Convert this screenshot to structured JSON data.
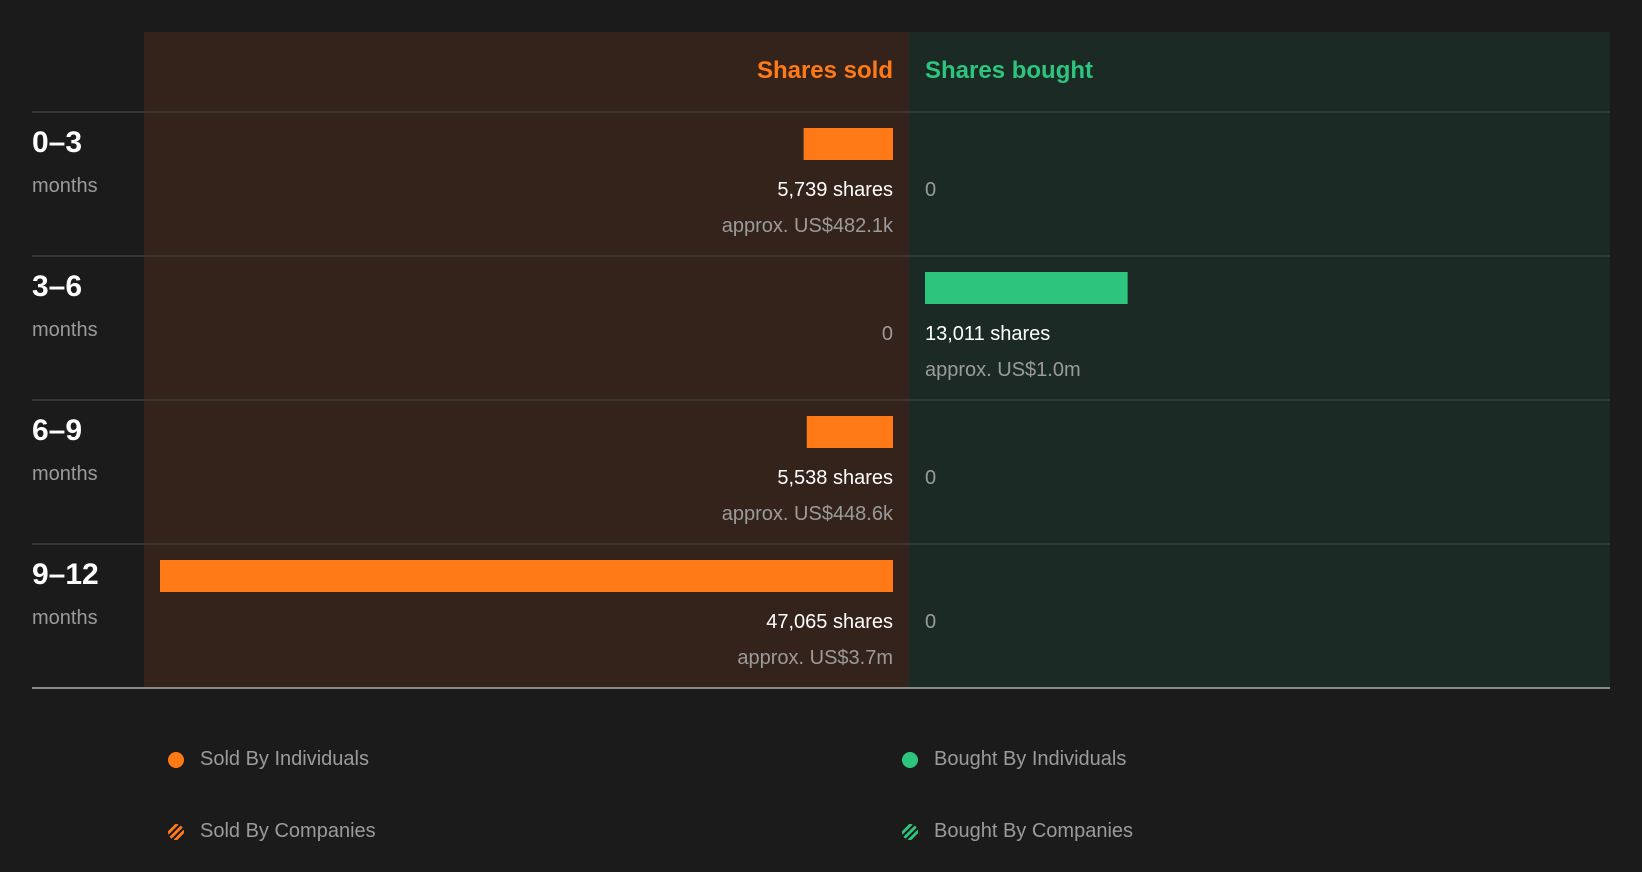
{
  "colors": {
    "background": "#1b1b1b",
    "sold_panel": "#33231b",
    "bought_panel": "#1b2a25",
    "sold": "#ff7a17",
    "bought": "#2dc57e",
    "divider": "#3d3d3d",
    "baseline": "#8a8a8a",
    "text_primary": "#ffffff",
    "text_secondary": "#9b9b9b"
  },
  "chart_data": {
    "type": "bar",
    "orientation": "horizontal-diverging",
    "columns": {
      "sold": "Shares sold",
      "bought": "Shares bought"
    },
    "categories": [
      {
        "range": "0–3",
        "unit": "months"
      },
      {
        "range": "3–6",
        "unit": "months"
      },
      {
        "range": "6–9",
        "unit": "months"
      },
      {
        "range": "9–12",
        "unit": "months"
      }
    ],
    "series": [
      {
        "key": "sold",
        "values": [
          5739,
          0,
          5538,
          47065
        ],
        "share_labels": [
          "5,739 shares",
          "0",
          "5,538 shares",
          "47,065 shares"
        ],
        "value_labels": [
          "approx. US$482.1k",
          "",
          "approx. US$448.6k",
          "approx. US$3.7m"
        ]
      },
      {
        "key": "bought",
        "values": [
          0,
          13011,
          0,
          0
        ],
        "share_labels": [
          "0",
          "13,011 shares",
          "0",
          "0"
        ],
        "value_labels": [
          "",
          "approx. US$1.0m",
          "",
          ""
        ]
      }
    ],
    "xlim": [
      0,
      47065
    ]
  },
  "legend": {
    "sold_individuals": "Sold By Individuals",
    "sold_companies": "Sold By Companies",
    "bought_individuals": "Bought By Individuals",
    "bought_companies": "Bought By Companies"
  }
}
